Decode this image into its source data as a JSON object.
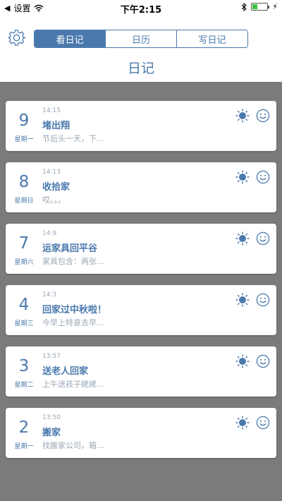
{
  "status": {
    "carrier": "设置",
    "time": "下午2:15",
    "battery_percent": 35
  },
  "nav": {
    "tabs": [
      {
        "label": "看日记",
        "active": true
      },
      {
        "label": "日历",
        "active": false
      },
      {
        "label": "写日记",
        "active": false
      }
    ],
    "title": "日记"
  },
  "colors": {
    "accent": "#4a79ad",
    "muted_text": "#9aa7b5",
    "background": "#7b7b7b"
  },
  "entries": [
    {
      "day": "9",
      "weekday": "星期一",
      "time": "14:15",
      "title": "堵出翔",
      "snippet": "节后头一天，下…",
      "weather_icon": "sun-icon",
      "mood_icon": "smile-icon"
    },
    {
      "day": "8",
      "weekday": "星期日",
      "time": "14:13",
      "title": "收拾家",
      "snippet": "哎。。。",
      "weather_icon": "sun-icon",
      "mood_icon": "smile-icon"
    },
    {
      "day": "7",
      "weekday": "星期六",
      "time": "14:9",
      "title": "运家具回平谷",
      "snippet": "家具包含：两张…",
      "weather_icon": "sun-icon",
      "mood_icon": "smile-icon"
    },
    {
      "day": "4",
      "weekday": "星期三",
      "time": "14:3",
      "title": "回家过中秋啦！",
      "snippet": "今早上特意去早…",
      "weather_icon": "sun-icon",
      "mood_icon": "smile-icon"
    },
    {
      "day": "3",
      "weekday": "星期二",
      "time": "13:57",
      "title": "送老人回家",
      "snippet": "上午送孩子姥姥…",
      "weather_icon": "sun-icon",
      "mood_icon": "smile-icon"
    },
    {
      "day": "2",
      "weekday": "星期一",
      "time": "13:50",
      "title": "搬家",
      "snippet": "找搬家公司，箱…",
      "weather_icon": "sun-icon",
      "mood_icon": "smile-icon"
    }
  ]
}
